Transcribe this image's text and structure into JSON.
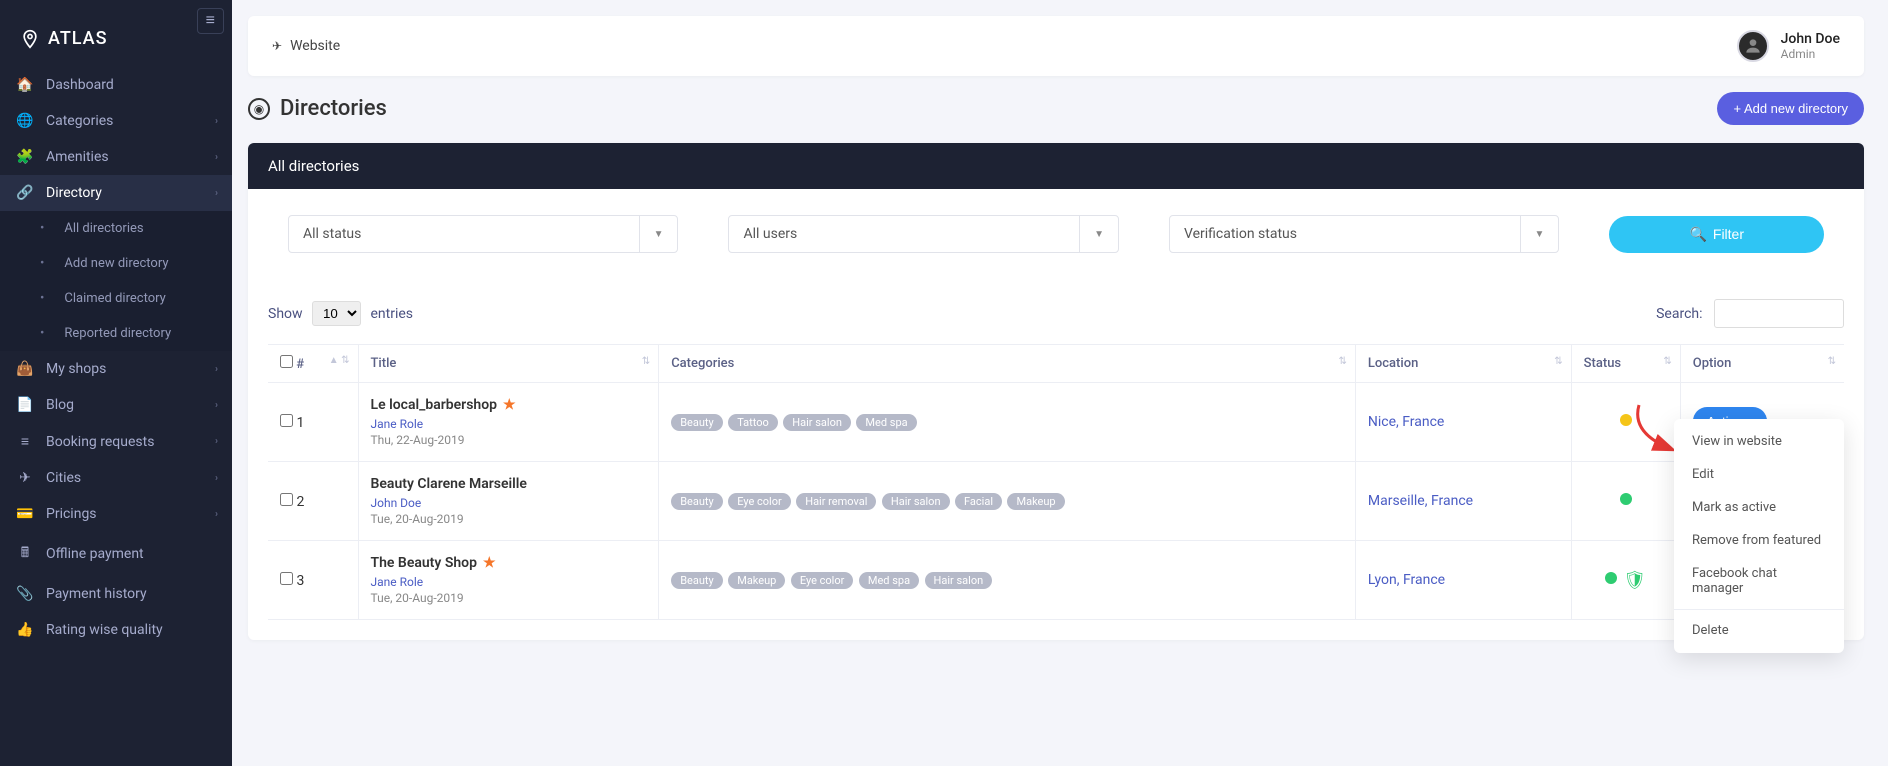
{
  "brand": "ATLAS",
  "topbar": {
    "website": "Website"
  },
  "user": {
    "name": "John Doe",
    "role": "Admin"
  },
  "sidebar": {
    "items": [
      {
        "label": "Dashboard",
        "icon": "home",
        "expandable": false
      },
      {
        "label": "Categories",
        "icon": "globe",
        "expandable": true
      },
      {
        "label": "Amenities",
        "icon": "puzzle",
        "expandable": true
      },
      {
        "label": "Directory",
        "icon": "sitemap",
        "expandable": true,
        "active": true
      },
      {
        "label": "My shops",
        "icon": "bag",
        "expandable": true
      },
      {
        "label": "Blog",
        "icon": "list",
        "expandable": true
      },
      {
        "label": "Booking requests",
        "icon": "lines",
        "expandable": true
      },
      {
        "label": "Cities",
        "icon": "plane",
        "expandable": true
      },
      {
        "label": "Pricings",
        "icon": "card",
        "expandable": true
      },
      {
        "label": "Offline payment",
        "icon": "calc",
        "expandable": false
      },
      {
        "label": "Payment history",
        "icon": "clip",
        "expandable": false
      },
      {
        "label": "Rating wise quality",
        "icon": "thumb",
        "expandable": false
      }
    ],
    "directory_sub": [
      "All directories",
      "Add new directory",
      "Claimed directory",
      "Reported directory"
    ]
  },
  "page": {
    "title": "Directories",
    "add_button": "+ Add new directory",
    "card_title": "All directories"
  },
  "filters": {
    "status": "All status",
    "users": "All users",
    "verification": "Verification status",
    "filter_btn": "Filter"
  },
  "table": {
    "show": "Show",
    "entries": "entries",
    "page_size": "10",
    "search_label": "Search:",
    "columns": [
      "#",
      "Title",
      "Categories",
      "Location",
      "Status",
      "Option"
    ],
    "action_label": "Action",
    "rows": [
      {
        "num": "1",
        "title": "Le local_barbershop",
        "featured": true,
        "author": "Jane Role",
        "date": "Thu, 22-Aug-2019",
        "categories": [
          "Beauty",
          "Tattoo",
          "Hair salon",
          "Med spa"
        ],
        "location": "Nice, France",
        "status": "yellow",
        "verified": false,
        "dropdown_open": true
      },
      {
        "num": "2",
        "title": "Beauty Clarene Marseille",
        "featured": false,
        "author": "John Doe",
        "date": "Tue, 20-Aug-2019",
        "categories": [
          "Beauty",
          "Eye color",
          "Hair removal",
          "Hair salon",
          "Facial",
          "Makeup"
        ],
        "location": "Marseille, France",
        "status": "green",
        "verified": false
      },
      {
        "num": "3",
        "title": "The Beauty Shop",
        "featured": true,
        "author": "Jane Role",
        "date": "Tue, 20-Aug-2019",
        "categories": [
          "Beauty",
          "Makeup",
          "Eye color",
          "Med spa",
          "Hair salon"
        ],
        "location": "Lyon, France",
        "status": "green",
        "verified": true
      }
    ]
  },
  "dropdown": {
    "items": [
      "View in website",
      "Edit",
      "Mark as active",
      "Remove from featured",
      "Facebook chat manager",
      "Delete"
    ]
  }
}
